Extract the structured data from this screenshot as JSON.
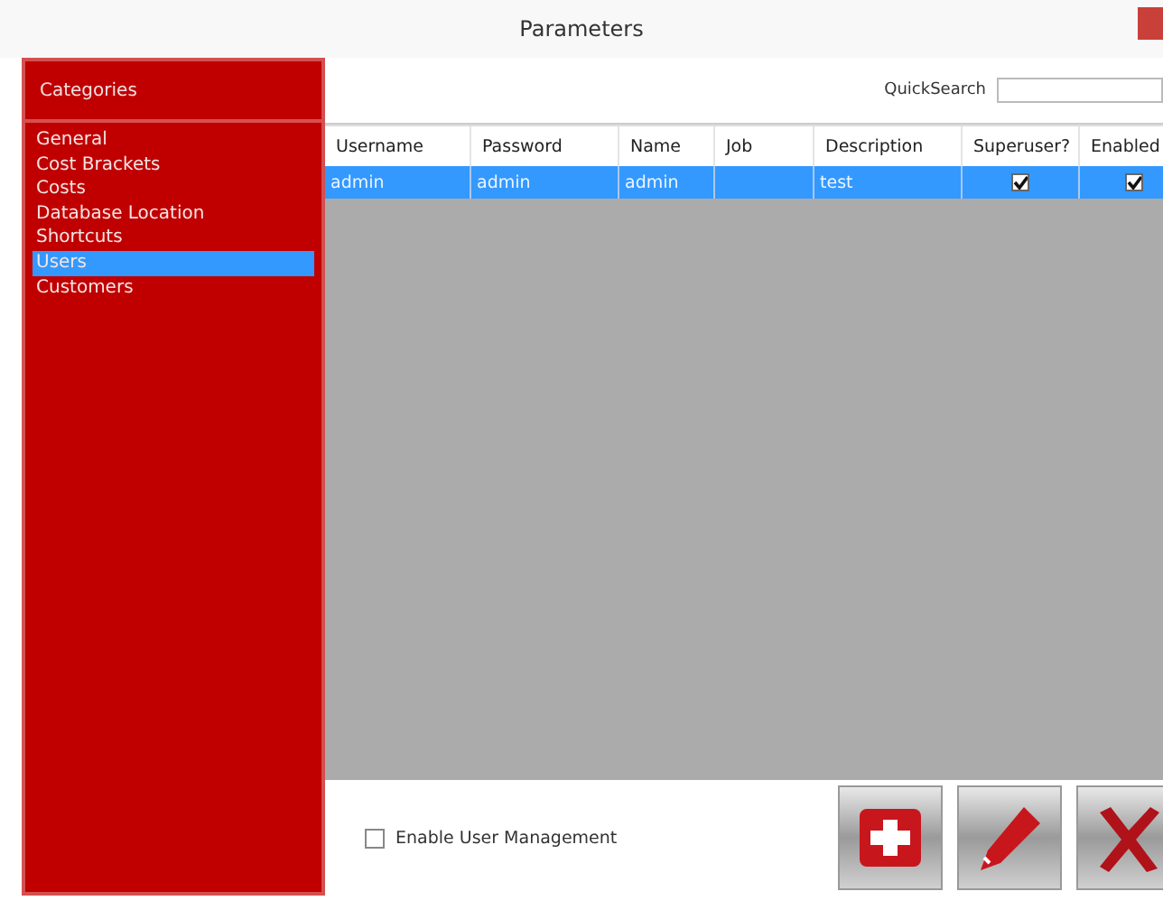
{
  "window": {
    "title": "Parameters"
  },
  "sidebar": {
    "title": "Categories",
    "items": [
      {
        "label": "General",
        "selected": false
      },
      {
        "label": "Cost Brackets",
        "selected": false
      },
      {
        "label": "Costs",
        "selected": false
      },
      {
        "label": "Database Location",
        "selected": false
      },
      {
        "label": "Shortcuts",
        "selected": false
      },
      {
        "label": "Users",
        "selected": true
      },
      {
        "label": "Customers",
        "selected": false
      }
    ]
  },
  "search": {
    "label": "QuickSearch"
  },
  "table": {
    "columns": [
      "Username",
      "Password",
      "Name",
      "Job",
      "Description",
      "Superuser?",
      "Enabled"
    ],
    "rows": [
      {
        "selected": true,
        "cells": [
          "admin",
          "admin",
          "admin",
          "",
          "test"
        ],
        "superuser": true,
        "enabled": true
      }
    ]
  },
  "enable_user_management": {
    "label": "Enable User Management",
    "checked": false
  }
}
